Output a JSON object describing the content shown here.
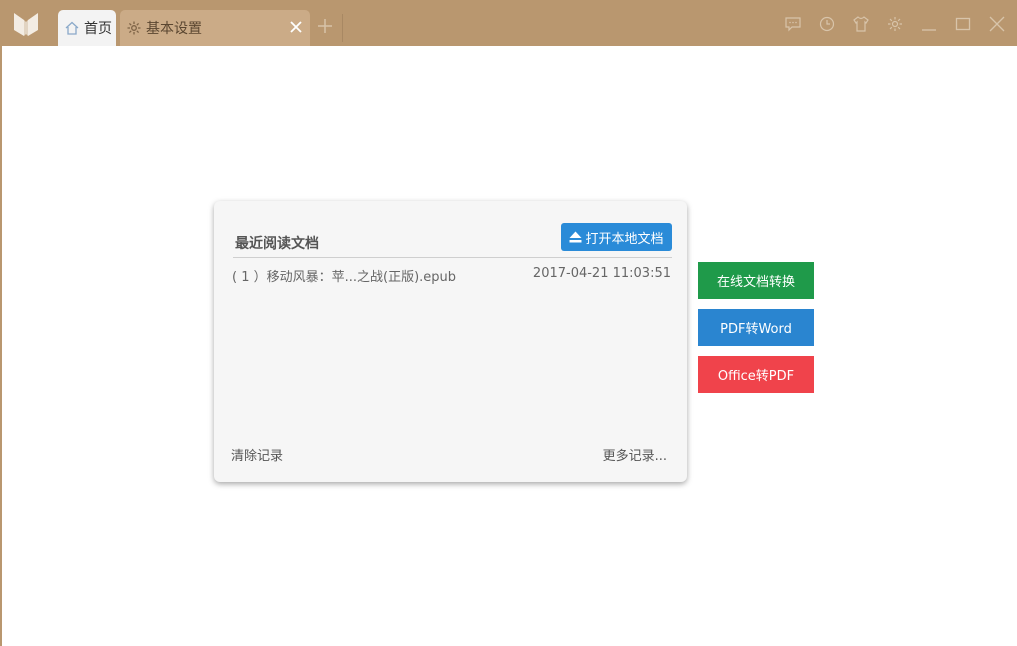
{
  "tabs": [
    {
      "label": "首页",
      "icon": "home-icon"
    },
    {
      "label": "基本设置",
      "icon": "gear-icon"
    }
  ],
  "window_controls": [
    "message-icon",
    "history-icon",
    "skin-icon",
    "settings-icon",
    "minimize-icon",
    "maximize-icon",
    "close-icon"
  ],
  "recent": {
    "title": "最近阅读文档",
    "open_button": "打开本地文档",
    "items": [
      {
        "name": "( 1 ）移动风暴：苹...之战(正版).epub",
        "time": "2017-04-21 11:03:51"
      }
    ],
    "clear_label": "清除记录",
    "more_label": "更多记录..."
  },
  "side_buttons": [
    {
      "label": "在线文档转换",
      "color": "#1f9a4a"
    },
    {
      "label": "PDF转Word",
      "color": "#2a85d0"
    },
    {
      "label": "Office转PDF",
      "color": "#f0434b"
    }
  ],
  "colors": {
    "frame": "#b9976f",
    "accent": "#2a8bd8"
  }
}
